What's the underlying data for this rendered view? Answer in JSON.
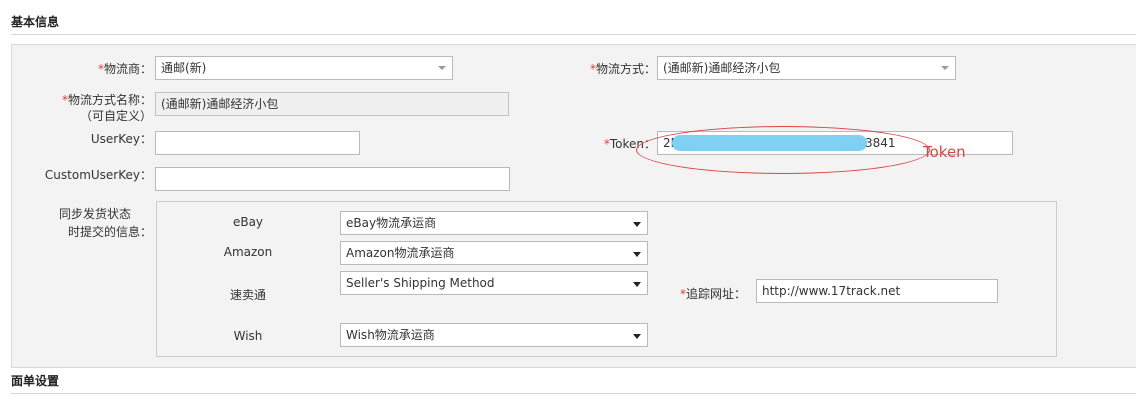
{
  "sections": {
    "basic_info": "基本信息",
    "form_settings": "面单设置"
  },
  "required_mark": "*",
  "fields": {
    "carrier": {
      "label": "物流商：",
      "value": "通邮(新)"
    },
    "shipping_method": {
      "label": "物流方式：",
      "value": "(通邮新)通邮经济小包"
    },
    "shipping_method_name": {
      "label_line1": "物流方式名称：",
      "label_line2": "（可自定义）",
      "value": "(通邮新)通邮经济小包"
    },
    "userkey": {
      "label": "UserKey：",
      "value": ""
    },
    "token": {
      "label": "Token：",
      "value_prefix": "2D",
      "value_suffix": "3841"
    },
    "custom_userkey": {
      "label": "CustomUserKey：",
      "value": ""
    },
    "sync_info": {
      "label_line1": "同步发货状态",
      "label_line2": "时提交的信息："
    },
    "tracking_url": {
      "label": "追踪网址：",
      "value": "http://www.17track.net"
    }
  },
  "platforms": [
    {
      "name": "eBay",
      "value": "eBay物流承运商"
    },
    {
      "name": "Amazon",
      "value": "Amazon物流承运商"
    },
    {
      "name": "速卖通",
      "value": "Seller's Shipping Method"
    },
    {
      "name": "Wish",
      "value": "Wish物流承运商"
    }
  ],
  "annotation": {
    "token_note": "Token"
  },
  "colors": {
    "required": "#e23b3b",
    "annotation": "#d94545",
    "mask": "#7fd0f3"
  }
}
